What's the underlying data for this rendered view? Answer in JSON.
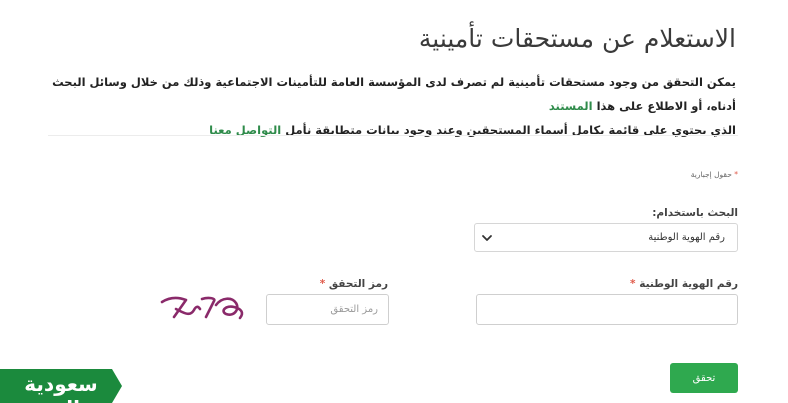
{
  "page": {
    "title": "الاستعلام عن مستحقات تأمينية",
    "intro": {
      "line1_part1": "يمكن التحقق من وجود مستحقات تأمينية لم تصرف لدى المؤسسة العامة للتأمينات الاجتماعية وذلك من خلال وسائل البحث أدناه، أو الاطلاع على هذا ",
      "line1_link": "المستند",
      "line2_part1": "الذي يحتوي على قائمة بكامل أسماء المستحقين وعند وجود بيانات متطابقة نأمل ",
      "line2_link": "التواصل معنا"
    },
    "required_note_star": "*",
    "required_note": "حقول إجبارية"
  },
  "form": {
    "search_by_label": "البحث باستخدام:",
    "search_by_value": "رقم الهوية الوطنية",
    "national_id_label": "رقم الهوية الوطنية",
    "national_id_star": "*",
    "national_id_value": "",
    "captcha_label": "رمز التحقق",
    "captcha_star": "*",
    "captcha_placeholder": "رمز التحقق",
    "captcha_value": "",
    "captcha_image_text": "7V78",
    "submit_label": "تحقق"
  },
  "logo": {
    "text": "سعودية العز"
  },
  "colors": {
    "accent": "#2fa94f",
    "link": "#2e8b4a",
    "required": "#e05a4a",
    "logo_band": "#1b8a3d",
    "captcha_ink": "#8a2a6a"
  },
  "icons": {
    "select_chevron": "chevron-down-icon"
  }
}
